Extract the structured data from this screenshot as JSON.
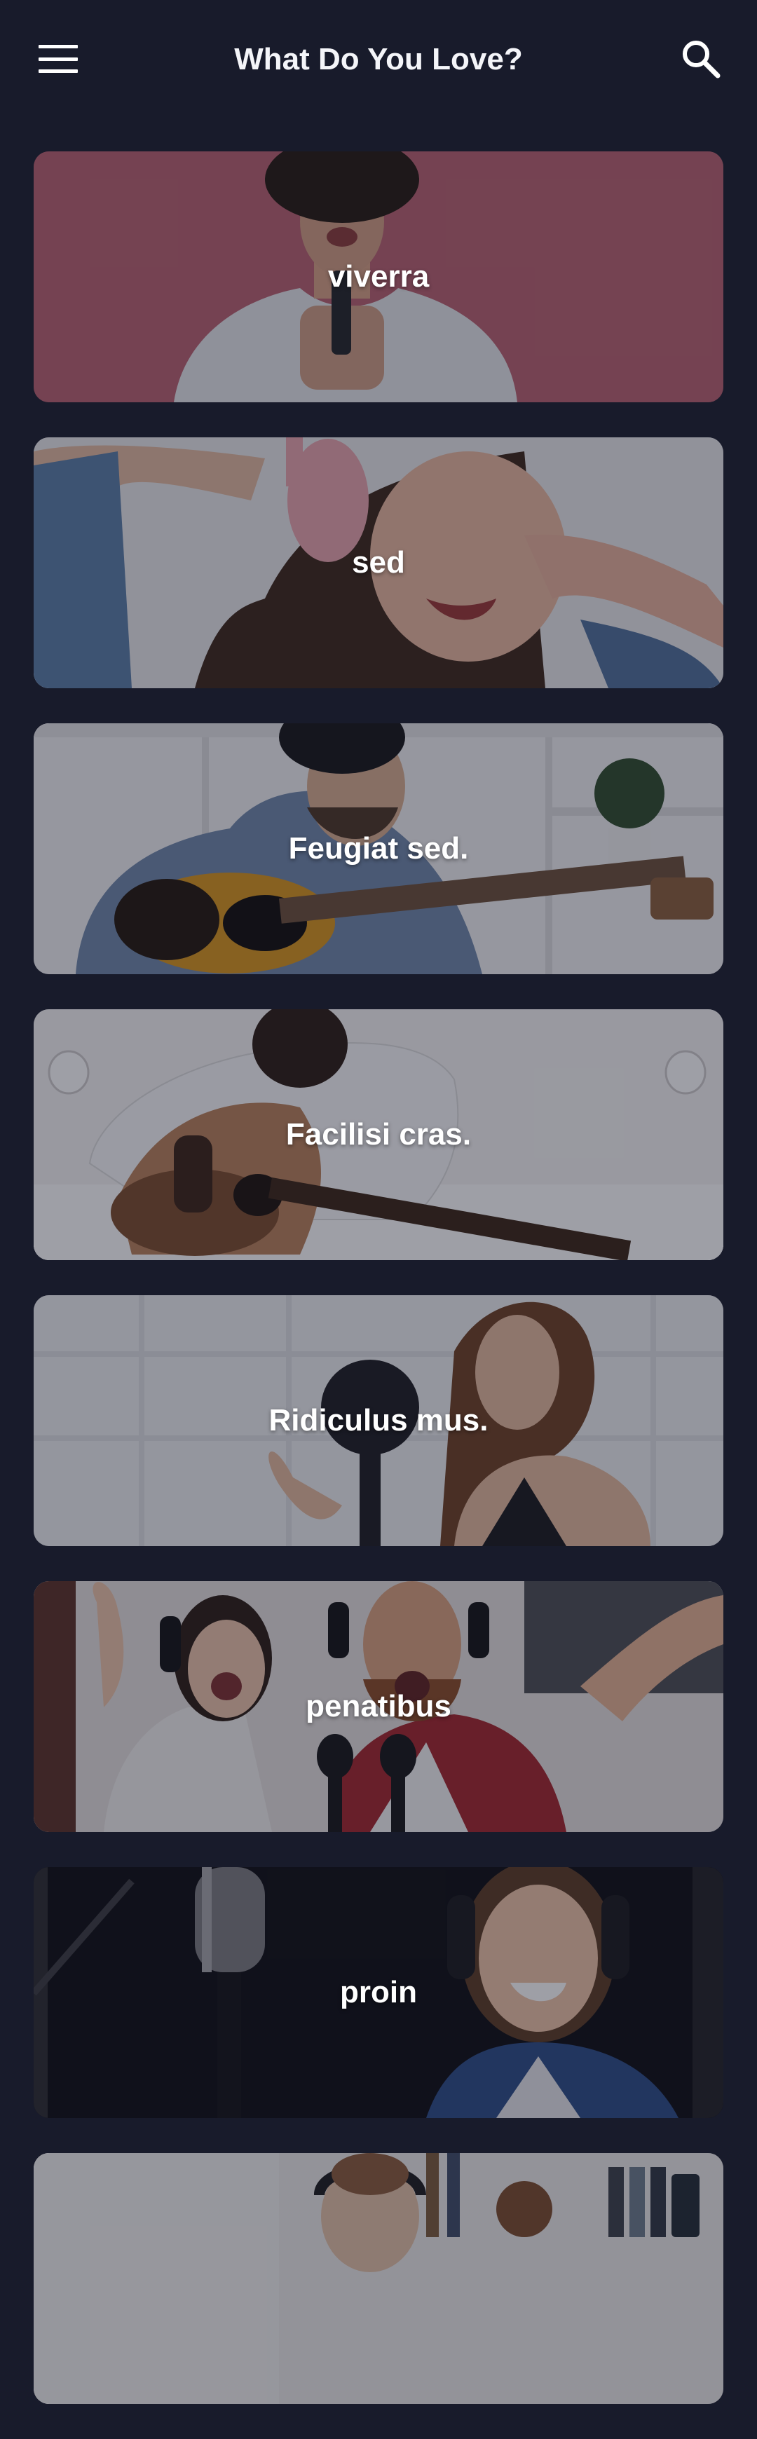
{
  "header": {
    "title": "What Do You Love?",
    "menu_icon": "hamburger-menu-icon",
    "search_icon": "search-icon"
  },
  "cards": [
    {
      "label": "viverra",
      "photo": "man-singing-into-microphone"
    },
    {
      "label": "sed",
      "photo": "woman-wearing-headphones"
    },
    {
      "label": "Feugiat sed.",
      "photo": "man-playing-acoustic-guitar"
    },
    {
      "label": "Facilisi cras.",
      "photo": "man-playing-guitar-on-bed"
    },
    {
      "label": "Ridiculus mus.",
      "photo": "woman-singing-at-studio-microphone"
    },
    {
      "label": "penatibus",
      "photo": "couple-singing-with-microphones"
    },
    {
      "label": "proin",
      "photo": "woman-with-headphones-in-studio"
    },
    {
      "label": "",
      "photo": "man-with-headphones-at-desk"
    }
  ],
  "colors": {
    "background": "#181b2b",
    "text": "#ffffff"
  }
}
